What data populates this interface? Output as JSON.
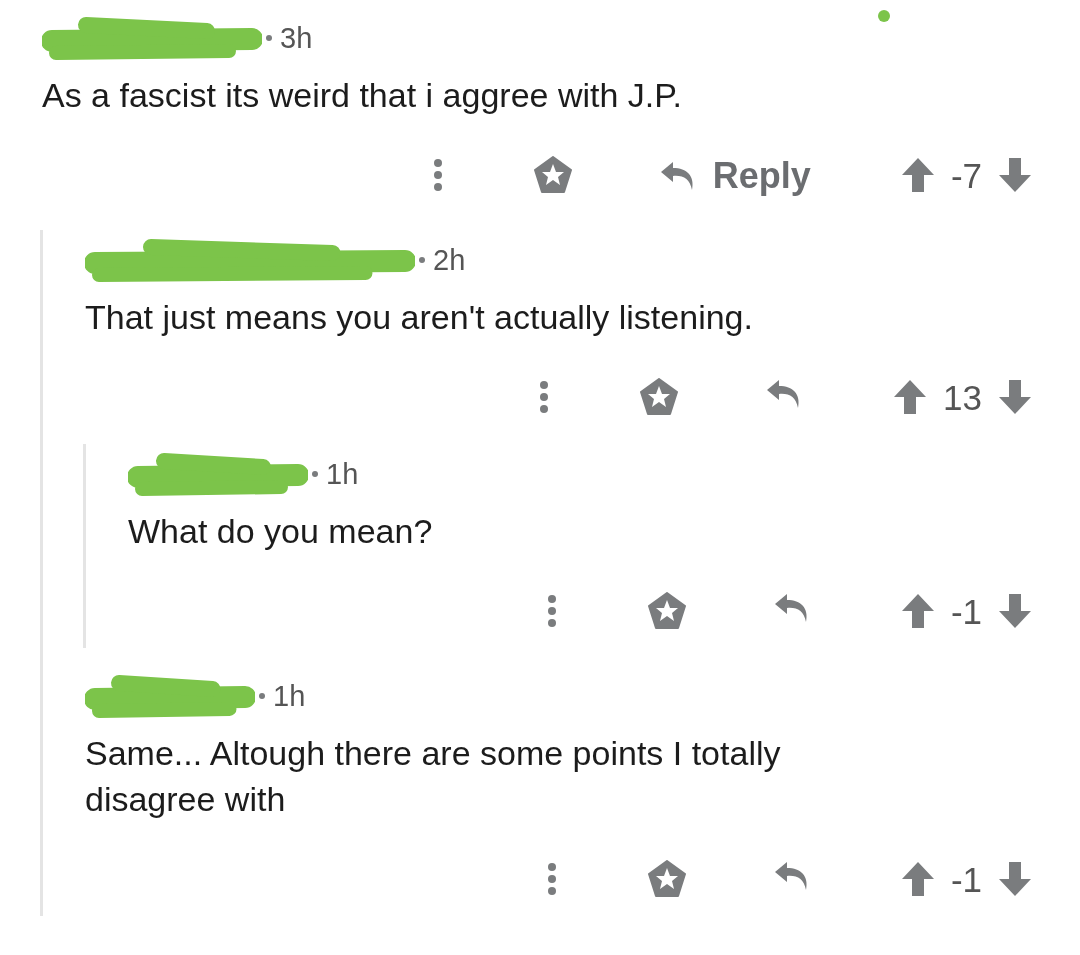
{
  "comments": [
    {
      "time": "3h",
      "body": "As a fascist its weird that i aggree with J.P.",
      "reply_label": "Reply",
      "score": "-7",
      "online": true,
      "children": [
        {
          "time": "2h",
          "body": "That just means you aren't actually listening.",
          "score": "13",
          "children": [
            {
              "time": "1h",
              "body": "What do you mean?",
              "score": "-1"
            }
          ]
        },
        {
          "time": "1h",
          "body": "Same... Altough there are some points I totally disagree with",
          "score": "-1"
        }
      ]
    }
  ]
}
